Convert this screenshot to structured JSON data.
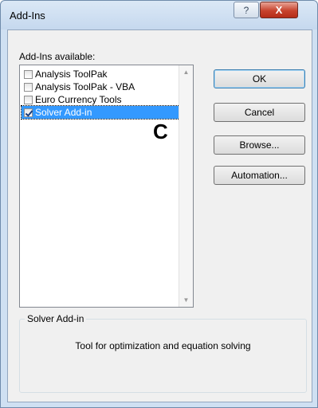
{
  "window": {
    "title": "Add-Ins",
    "help_glyph": "?",
    "close_glyph": "X"
  },
  "list": {
    "label": "Add-Ins available:",
    "items": [
      {
        "label": "Analysis ToolPak",
        "checked": false,
        "selected": false
      },
      {
        "label": "Analysis ToolPak - VBA",
        "checked": false,
        "selected": false
      },
      {
        "label": "Euro Currency Tools",
        "checked": false,
        "selected": false
      },
      {
        "label": "Solver Add-in",
        "checked": true,
        "selected": true
      }
    ],
    "scroll_up_glyph": "▲",
    "scroll_down_glyph": "▼"
  },
  "annotation": "C",
  "buttons": {
    "ok": "OK",
    "cancel": "Cancel",
    "browse": "Browse...",
    "automation": "Automation..."
  },
  "details": {
    "title": "Solver Add-in",
    "description": "Tool for optimization and equation solving"
  },
  "colors": {
    "selection": "#3399ff",
    "close_button": "#c7432d",
    "frame": "#cfe0f2"
  }
}
